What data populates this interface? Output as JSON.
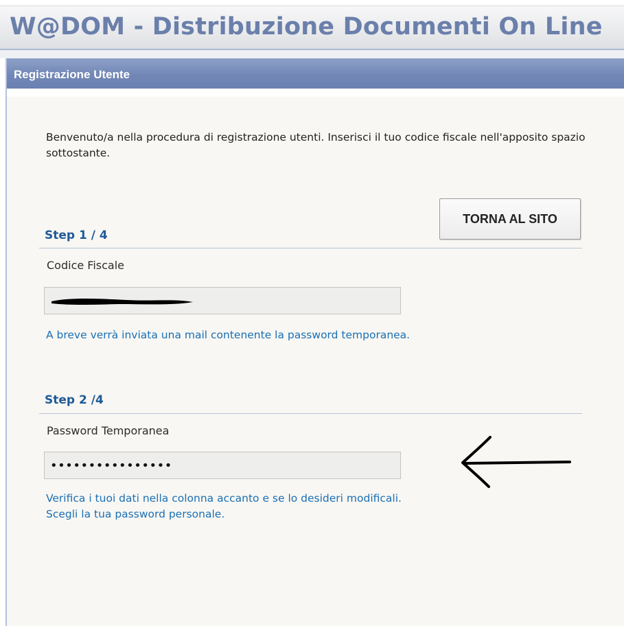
{
  "header": {
    "title": "W@DOM - Distribuzione Documenti On Line"
  },
  "panel": {
    "title": "Registrazione Utente",
    "intro": "Benvenuto/a nella procedura di registrazione utenti. Inserisci il tuo codice fiscale nell'apposito spazio sottostante.",
    "back_button": "TORNA AL SITO"
  },
  "step1": {
    "title": "Step 1 / 4",
    "label": "Codice Fiscale",
    "info": "A breve verrà inviata una mail contenente la password temporanea."
  },
  "step2": {
    "title": "Step 2 /4",
    "label": "Password Temporanea",
    "value": "••••••••••••••••",
    "info_line1": "Verifica i tuoi dati nella colonna accanto e se lo desideri modificali.",
    "info_line2": "Scegli la tua password personale."
  },
  "colors": {
    "header_text": "#6b7fab",
    "panel_header": "#7287b6",
    "step_title": "#1f5a99",
    "info_text": "#1a6fb5"
  }
}
